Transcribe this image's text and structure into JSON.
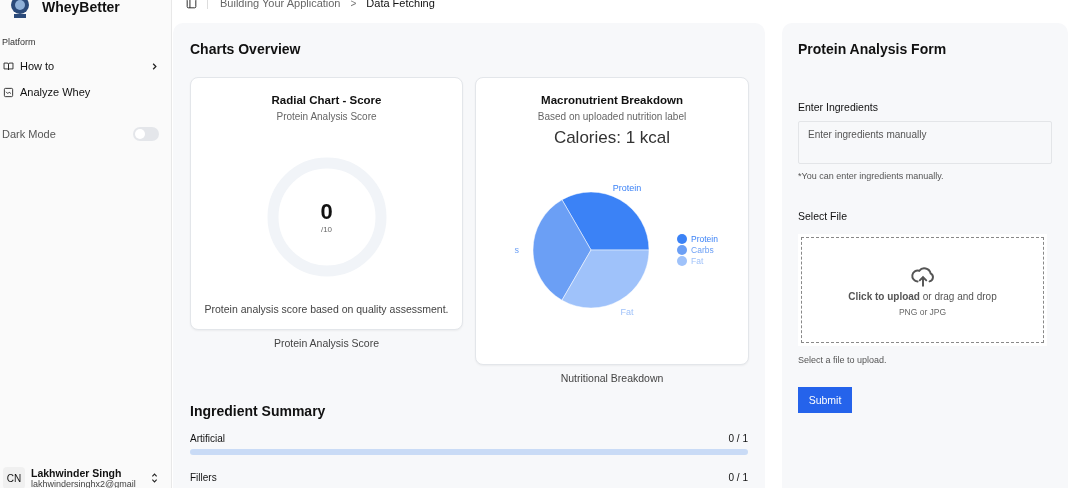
{
  "sidebar": {
    "brand": "WheyBetter",
    "group_label": "Platform",
    "items": [
      {
        "label": "How to",
        "kind": "book",
        "expandable": true
      },
      {
        "label": "Analyze Whey",
        "kind": "chart",
        "expandable": false
      }
    ],
    "dark_mode": {
      "label": "Dark Mode",
      "on": false
    },
    "user": {
      "initials": "CN",
      "name": "Lakhwinder Singh",
      "email": "lakhwindersinghx2@gmail"
    }
  },
  "breadcrumb_separator": ">",
  "breadcrumbs": [
    {
      "label": "Building Your Application",
      "current": false
    },
    {
      "label": "Data Fetching",
      "current": true
    }
  ],
  "charts_overview": {
    "title": "Charts Overview",
    "radial_card": {
      "title": "Radial Chart - Score",
      "subtitle": "Protein Analysis Score",
      "score": "0",
      "max": "/10",
      "footer": "Protein analysis score based on quality assessment.",
      "caption": "Protein Analysis Score"
    },
    "macro_card": {
      "title": "Macronutrient Breakdown",
      "subtitle": "Based on uploaded nutrition label",
      "calories": "Calories: 1 kcal",
      "caption": "Nutritional Breakdown",
      "chart_data": {
        "type": "pie",
        "categories": [
          "Protein",
          "Carbs",
          "Fat"
        ],
        "values": [
          33.33,
          33.33,
          33.34
        ],
        "annotations": [
          "Protein",
          "s",
          "Fat"
        ],
        "legend": "right"
      },
      "slices": [
        {
          "color": "#3b82f6"
        },
        {
          "color": "#6b9ff5"
        },
        {
          "color": "#9fc2fa"
        }
      ]
    }
  },
  "ingredient_summary": {
    "title": "Ingredient Summary",
    "rows": [
      {
        "label": "Artificial",
        "count": "0 / 1",
        "level": 0
      },
      {
        "label": "Fillers",
        "count": "0 / 1"
      }
    ]
  },
  "form": {
    "title": "Protein Analysis Form",
    "ingredients_label": "Enter Ingredients",
    "ingredients_placeholder": "Enter ingredients manually",
    "ingredients_hint": "*You can enter ingredients manually.",
    "file_label": "Select File",
    "upload_action": "Click to upload",
    "upload_rest": "or drag and drop",
    "upload_types": "PNG or JPG",
    "file_hint": "Select a file to upload.",
    "submit": "Submit"
  }
}
